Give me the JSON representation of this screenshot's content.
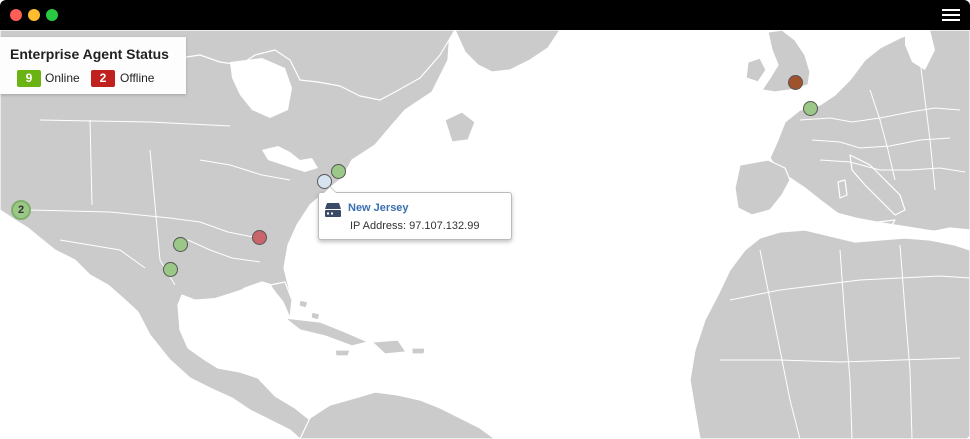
{
  "window": {
    "traffic_lights": [
      "#ff5f57",
      "#febc2e",
      "#28c840"
    ]
  },
  "legend": {
    "title": "Enterprise Agent Status",
    "online": {
      "count": "9",
      "label": "Online",
      "color": "#6bb313"
    },
    "offline": {
      "count": "2",
      "label": "Offline",
      "color": "#c0211f"
    }
  },
  "map": {
    "land_color": "#cbcbcb",
    "border_color": "#ffffff",
    "online_marker_color": "#9bc886",
    "offline_marker_color": "#c8666b",
    "selected_marker_color": "#d6e4f0",
    "london_marker_color": "#a0522d"
  },
  "markers": [
    {
      "status": "cluster",
      "count": "2"
    },
    {
      "status": "online"
    },
    {
      "status": "online"
    },
    {
      "status": "offline"
    },
    {
      "status": "online"
    },
    {
      "status": "selected"
    },
    {
      "status": "offline-london"
    },
    {
      "status": "online"
    }
  ],
  "tooltip": {
    "icon": "server-icon",
    "title": "New Jersey",
    "ip": "IP Address: 97.107.132.99"
  }
}
